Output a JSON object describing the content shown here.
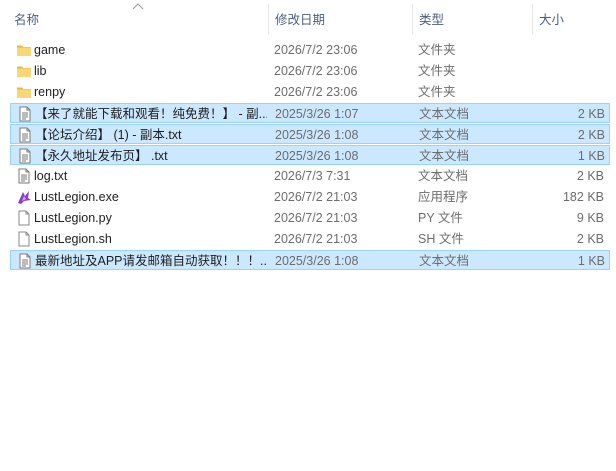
{
  "header": {
    "name": "名称",
    "date": "修改日期",
    "type": "类型",
    "size": "大小"
  },
  "files": [
    {
      "name": "game",
      "date": "2026/7/2 23:06",
      "type": "文件夹",
      "size": "",
      "icon": "folder-icon",
      "selected": false
    },
    {
      "name": "lib",
      "date": "2026/7/2 23:06",
      "type": "文件夹",
      "size": "",
      "icon": "folder-icon",
      "selected": false
    },
    {
      "name": "renpy",
      "date": "2026/7/2 23:06",
      "type": "文件夹",
      "size": "",
      "icon": "folder-icon",
      "selected": false
    },
    {
      "name": "【来了就能下载和观看！纯免费！】 - 副...",
      "date": "2025/3/26 1:07",
      "type": "文本文档",
      "size": "2 KB",
      "icon": "text-file-icon",
      "selected": true
    },
    {
      "name": "【论坛介绍】 (1) - 副本.txt",
      "date": "2025/3/26 1:08",
      "type": "文本文档",
      "size": "2 KB",
      "icon": "text-file-icon",
      "selected": true
    },
    {
      "name": "【永久地址发布页】 .txt",
      "date": "2025/3/26 1:08",
      "type": "文本文档",
      "size": "1 KB",
      "icon": "text-file-icon",
      "selected": true
    },
    {
      "name": "log.txt",
      "date": "2026/7/3 7:31",
      "type": "文本文档",
      "size": "2 KB",
      "icon": "text-file-icon",
      "selected": false
    },
    {
      "name": "LustLegion.exe",
      "date": "2026/7/2 21:03",
      "type": "应用程序",
      "size": "182 KB",
      "icon": "exe-app-icon",
      "selected": false
    },
    {
      "name": "LustLegion.py",
      "date": "2026/7/2 21:03",
      "type": "PY 文件",
      "size": "9 KB",
      "icon": "blank-file-icon",
      "selected": false
    },
    {
      "name": "LustLegion.sh",
      "date": "2026/7/2 21:03",
      "type": "SH 文件",
      "size": "2 KB",
      "icon": "blank-file-icon",
      "selected": false
    },
    {
      "name": "最新地址及APP请发邮箱自动获取！！！...",
      "date": "2025/3/26 1:08",
      "type": "文本文档",
      "size": "1 KB",
      "icon": "text-file-icon",
      "selected": true
    }
  ],
  "colors": {
    "selection_fill": "#cce8ff",
    "selection_border": "#99d1ff",
    "header_text": "#4d6082",
    "folder": "#f8d775"
  }
}
